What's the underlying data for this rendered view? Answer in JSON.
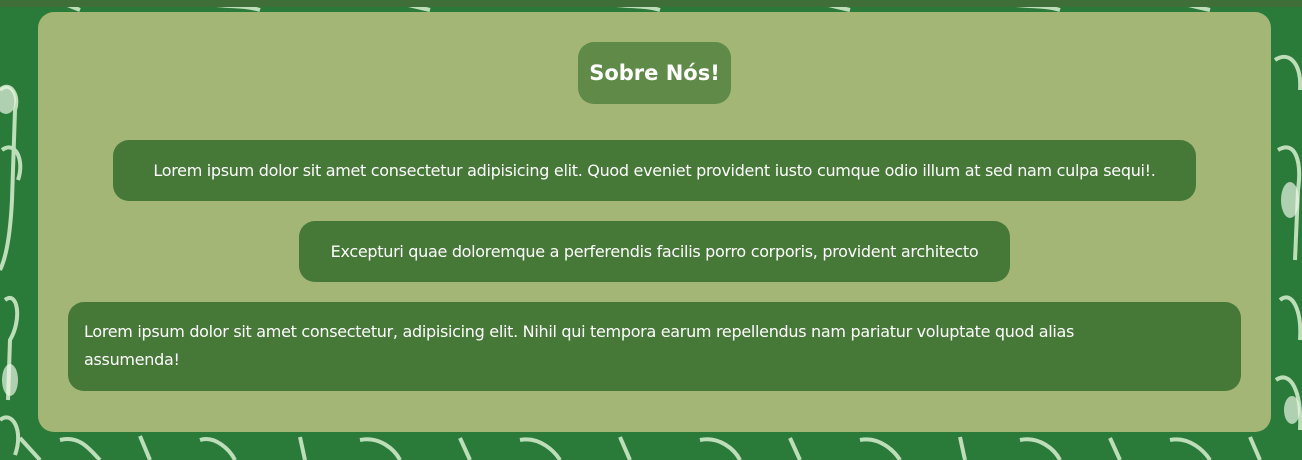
{
  "about": {
    "title": "Sobre Nós!",
    "paragraphs": [
      "Lorem ipsum dolor sit amet consectetur adipisicing elit. Quod eveniet provident iusto cumque odio illum at sed nam culpa sequi!.",
      "Excepturi quae doloremque a perferendis facilis porro corporis, provident architecto",
      "Lorem ipsum dolor sit amet consectetur, adipisicing elit. Nihil qui tempora earum repellendus nam pariatur voluptate quod alias assumenda!"
    ]
  },
  "colors": {
    "background": "#2e7d3c",
    "panel": "#bec382",
    "pill": "#467838",
    "title_pill": "#5f8a48",
    "text": "#ffffff"
  },
  "background_image": "green-cups-pattern"
}
